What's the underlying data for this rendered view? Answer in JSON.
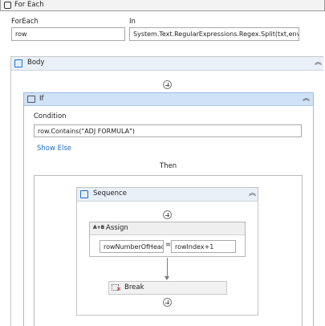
{
  "foreach": {
    "title": "For Each",
    "foreach_label": "ForEach",
    "foreach_value": "row",
    "in_label": "In",
    "in_value": "System.Text.RegularExpressions.Regex.Split(txt,envir"
  },
  "body": {
    "title": "Body"
  },
  "if": {
    "title": "If",
    "condition_label": "Condition",
    "condition_value": "row.Contains(\"ADJ FORMULA\")",
    "show_else": "Show Else",
    "then_label": "Then"
  },
  "sequence": {
    "title": "Sequence"
  },
  "assign": {
    "title": "Assign",
    "to_value": "rowNumberOfHeac",
    "equals": "=",
    "value": "rowIndex+1"
  },
  "break": {
    "title": "Break"
  },
  "colors": {
    "accent": "#1f6fc5",
    "header": "#eaf0f8",
    "selected_header": "#cfe2f7"
  }
}
